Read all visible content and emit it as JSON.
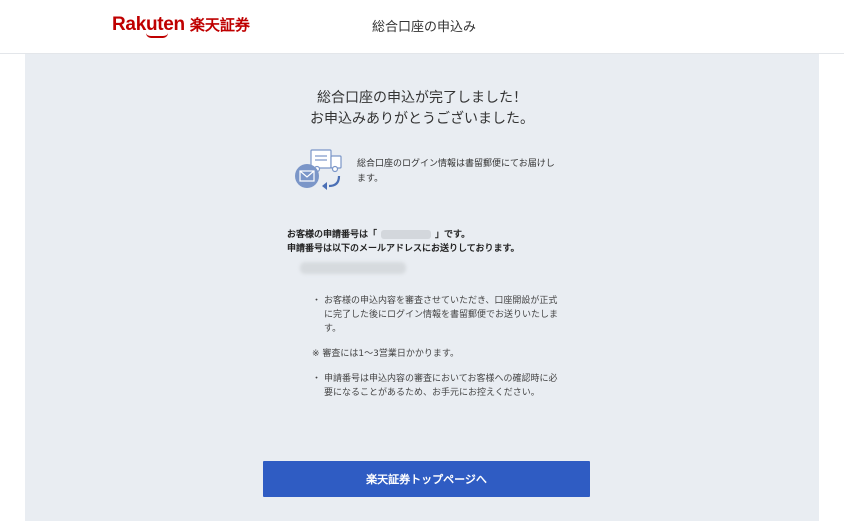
{
  "header": {
    "logo_en": "Rakuten",
    "logo_ja": "楽天証券",
    "title": "総合口座の申込み"
  },
  "main": {
    "headline_line1": "総合口座の申込が完了しました！",
    "headline_line2": "お申込みありがとうございました。",
    "mail_icon": "mail-delivery-icon",
    "mail_notice": "総合口座のログイン情報は書留郵便にてお届けします。",
    "application_prefix": "お客様の申請番号は「",
    "application_suffix": "」です。",
    "application_sent": "申請番号は以下のメールアドレスにお送りしております。",
    "notes": [
      {
        "mark": "・",
        "text": "お客様の申込内容を審査させていただき、口座開設が正式に完了した後にログイン情報を書留郵便でお送りいたします。"
      },
      {
        "mark": "※",
        "text": "審査には1〜3営業日かかります。"
      },
      {
        "mark": "・",
        "text": "申請番号は申込内容の審査においてお客様への確認時に必要になることがあるため、お手元にお控えください。"
      }
    ],
    "cta_label": "楽天証券トップページへ"
  },
  "colors": {
    "brand": "#bf0000",
    "panel_bg": "#e9edf2",
    "cta_bg": "#2f5cc3"
  }
}
